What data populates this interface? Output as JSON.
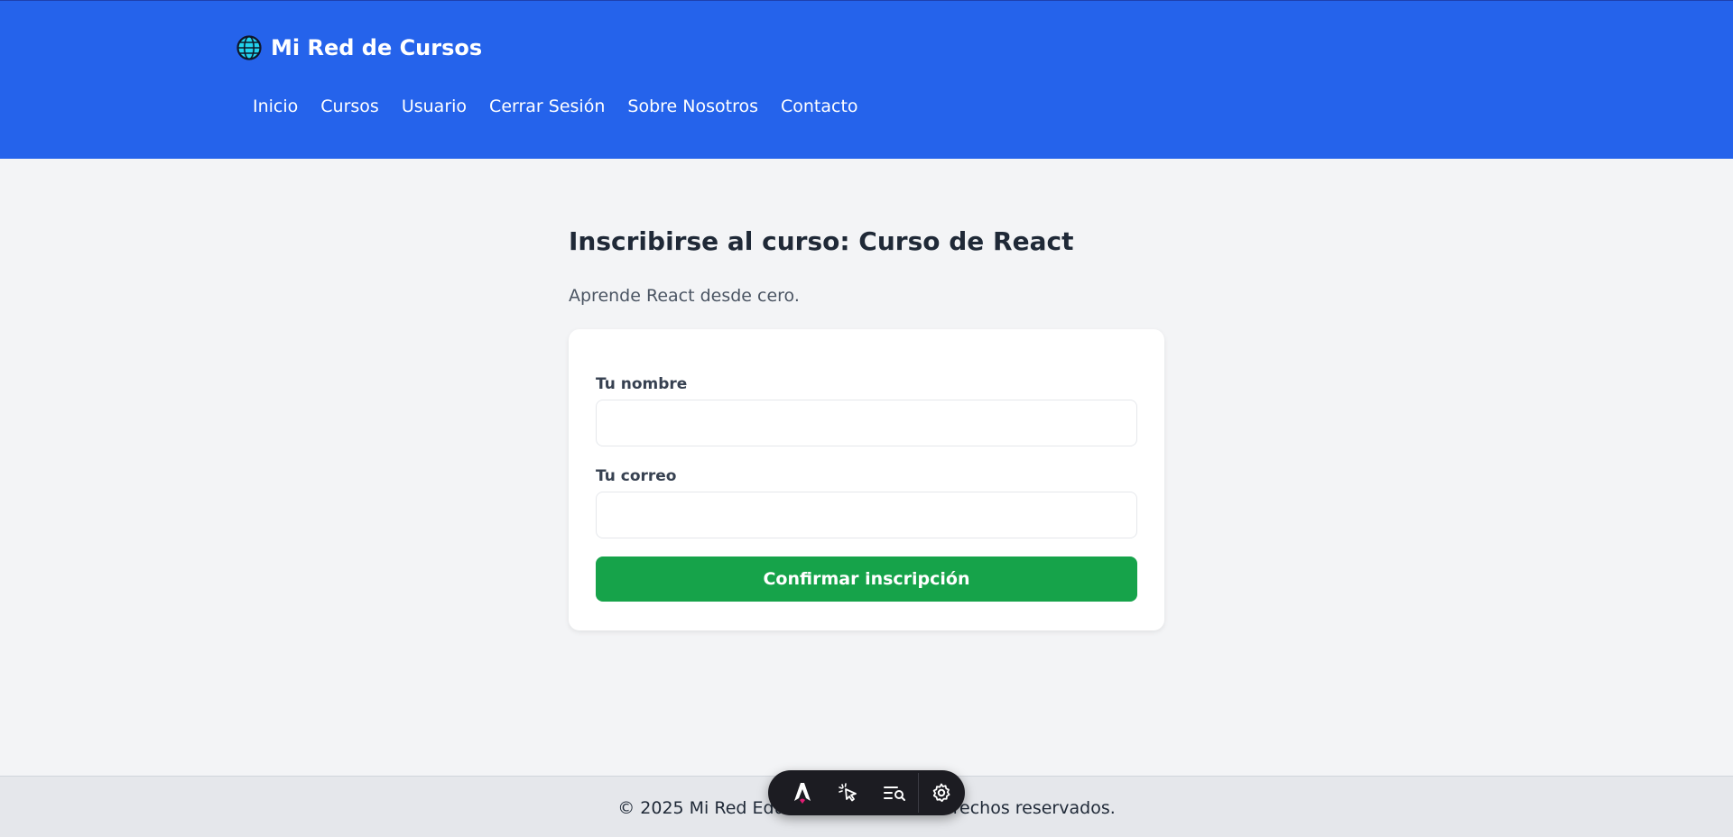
{
  "header": {
    "brand": "Mi Red de Cursos",
    "nav": [
      "Inicio",
      "Cursos",
      "Usuario",
      "Cerrar Sesión",
      "Sobre Nosotros",
      "Contacto"
    ]
  },
  "main": {
    "title": "Inscribirse al curso: Curso de React",
    "description": "Aprende React desde cero.",
    "form": {
      "name_label": "Tu nombre",
      "name_value": "",
      "email_label": "Tu correo",
      "email_value": "",
      "submit_label": "Confirmar inscripción"
    }
  },
  "footer": {
    "text": "© 2025 Mi Red Educativa. Todos los derechos reservados."
  },
  "devtoolbar": {
    "items": [
      "astro-logo-icon",
      "inspect-cursor-icon",
      "audit-icon",
      "settings-gear-icon"
    ]
  },
  "colors": {
    "header_bg": "#2563eb",
    "page_bg": "#f3f4f6",
    "submit_bg": "#16a34a",
    "footer_bg": "#e5e7eb"
  }
}
